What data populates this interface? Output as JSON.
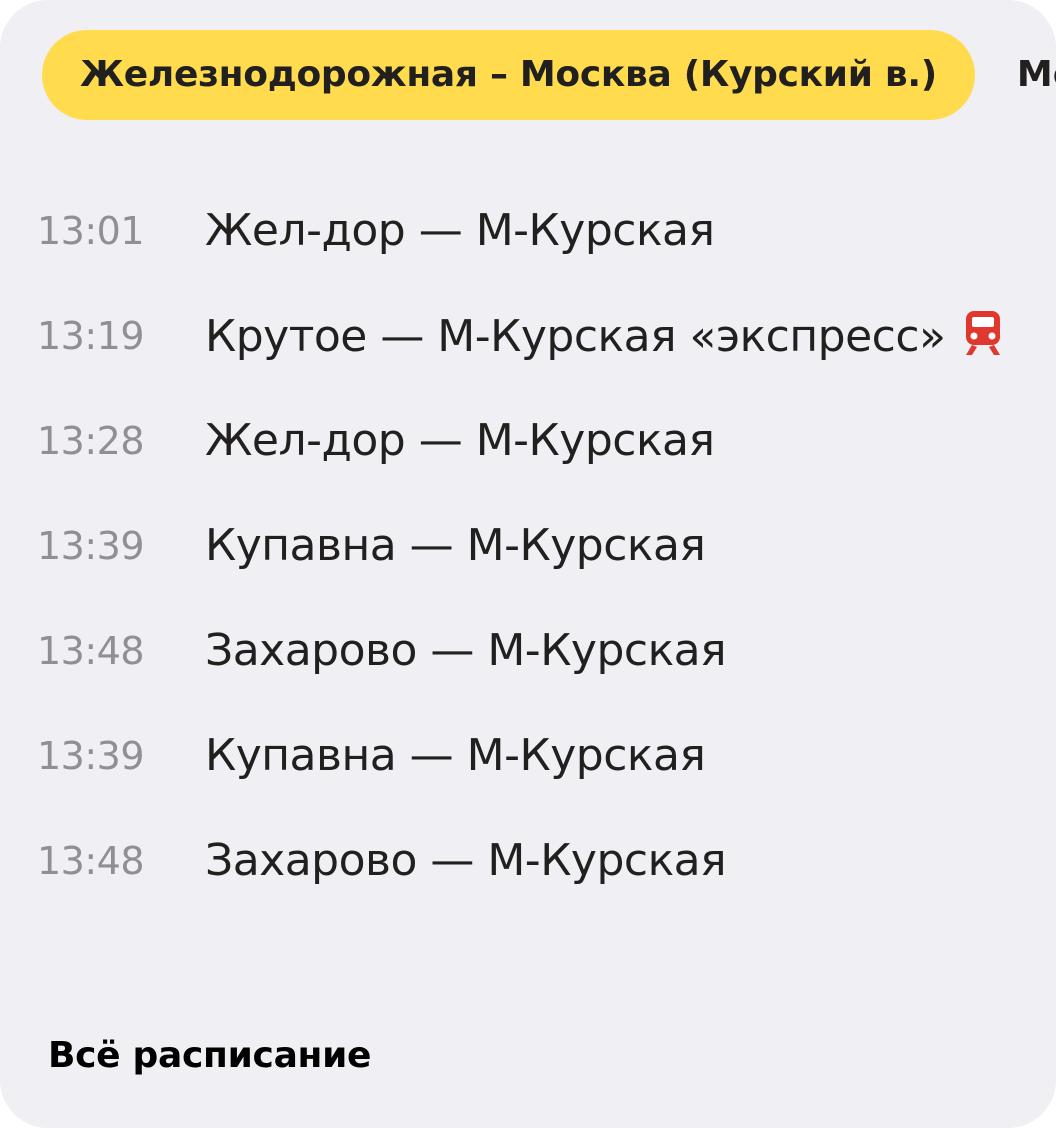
{
  "tabs": [
    {
      "label": "Железнодорожная – Москва (Курский в.)",
      "active": true
    },
    {
      "label": "Мос",
      "active": false
    }
  ],
  "schedule": [
    {
      "time": "13:01",
      "route": "Жел-дор — М-Курская",
      "express": false
    },
    {
      "time": "13:19",
      "route": "Крутое — М-Курская «экспресс»",
      "express": true
    },
    {
      "time": "13:28",
      "route": "Жел-дор — М-Курская",
      "express": false
    },
    {
      "time": "13:39",
      "route": "Купавна — М-Курская",
      "express": false
    },
    {
      "time": "13:48",
      "route": "Захарово — М-Курская",
      "express": false
    },
    {
      "time": "13:39",
      "route": "Купавна — М-Курская",
      "express": false
    },
    {
      "time": "13:48",
      "route": "Захарово — М-Курская",
      "express": false
    }
  ],
  "footer": {
    "all_schedule_label": "Всё расписание"
  },
  "colors": {
    "accent": "#ffdb4d",
    "background": "#efeff4",
    "express_icon": "#e0382e",
    "time_text": "#8f8f94"
  },
  "icons": {
    "express": "train-icon"
  }
}
